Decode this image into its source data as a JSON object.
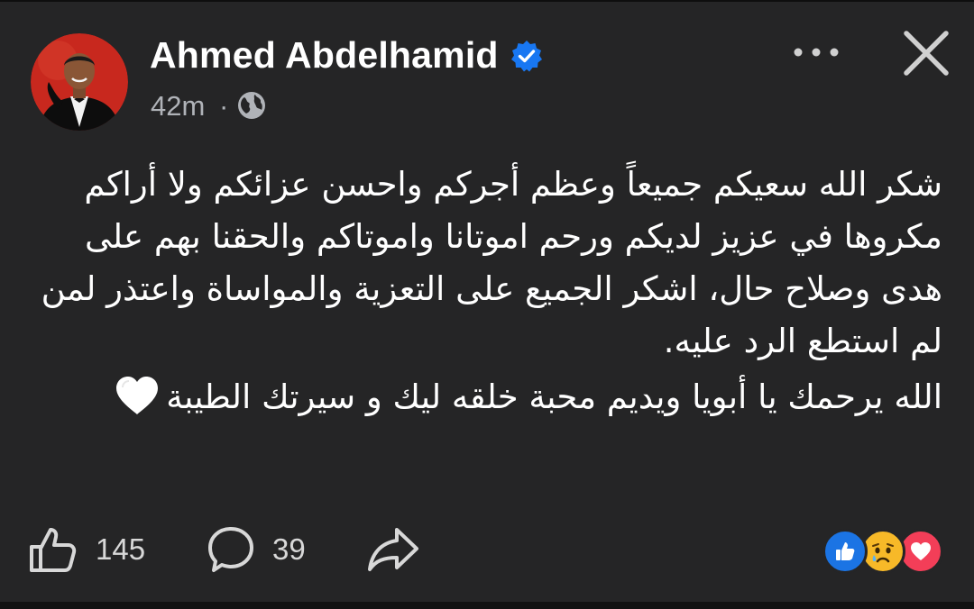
{
  "post": {
    "author": {
      "name": "Ahmed Abdelhamid",
      "verified": true,
      "avatar": "avatar-photo-man-in-tuxedo-red-background"
    },
    "time": "42m",
    "separator": "·",
    "privacy_icon": "globe-icon",
    "header_actions": [
      "more-icon",
      "close-icon"
    ],
    "body_lines": [
      "شكر الله سعيكم جميعاً وعظم أجركم واحسن عزائكم ولا أراكم",
      "مكروها في عزيز لديكم ورحم اموتانا واموتاكم والحقنا بهم على",
      "هدى وصلاح حال، اشكر الجميع على التعزية والمواساة واعتذر لمن",
      "لم استطع الرد عليه."
    ],
    "closing_line": "الله يرحمك يا أبويا ويديم محبة خلقه ليك و سيرتك الطيبة",
    "closing_emoji": "white-heart-icon",
    "like_count": "145",
    "comment_count": "39",
    "reactions": [
      "like",
      "sad",
      "love"
    ]
  },
  "colors": {
    "background": "#252526",
    "text": "#ffffff",
    "secondary_text": "#b0b3b8",
    "verified": "#1877f2",
    "like_reaction": "#1b74e4",
    "sad_reaction": "#f7b928",
    "love_reaction": "#f33e58"
  }
}
